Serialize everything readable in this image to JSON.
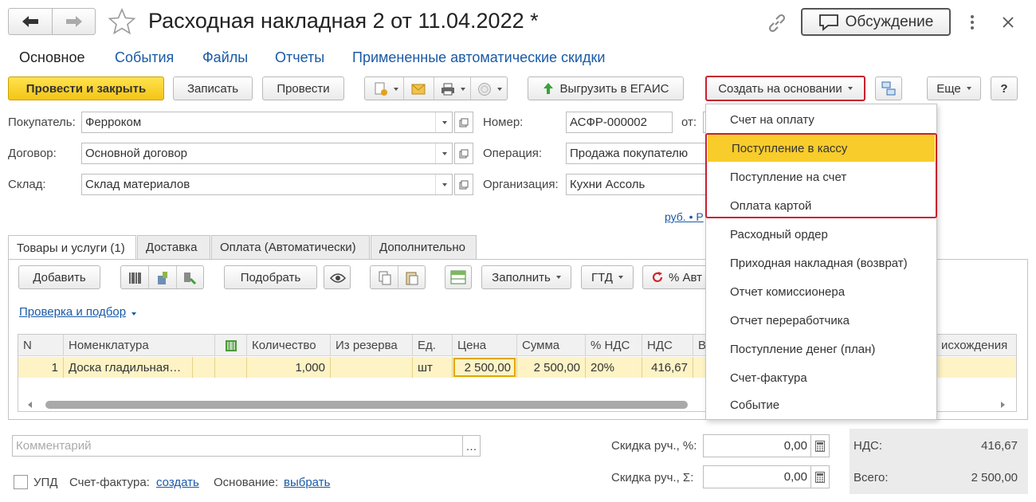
{
  "window": {
    "title": "Расходная накладная 2 от 11.04.2022 *",
    "discussion": "Обсуждение"
  },
  "tabs": [
    "Основное",
    "События",
    "Файлы",
    "Отчеты",
    "Примененные автоматические скидки"
  ],
  "toolbar": {
    "post_close": "Провести и закрыть",
    "save": "Записать",
    "post": "Провести",
    "upload_egais": "Выгрузить в ЕГАИС",
    "create_based": "Создать на основании",
    "more": "Еще",
    "help": "?"
  },
  "form": {
    "buyer_label": "Покупатель:",
    "buyer": "Ферроком",
    "contract_label": "Договор:",
    "contract": "Основной договор",
    "warehouse_label": "Склад:",
    "warehouse": "Склад материалов",
    "number_label": "Номер:",
    "number": "АСФР-000002",
    "from_label": "от:",
    "operation_label": "Операция:",
    "operation": "Продажа покупателю",
    "org_label": "Организация:",
    "org": "Кухни Ассоль",
    "currency_link": "руб. • Р"
  },
  "inner_tabs": [
    "Товары и услуги (1)",
    "Доставка",
    "Оплата (Автоматически)",
    "Дополнительно"
  ],
  "goods_toolbar": {
    "add": "Добавить",
    "pick": "Подобрать",
    "fill": "Заполнить",
    "gtd": "ГТД",
    "percent": "% Авт"
  },
  "check_link": "Проверка и подбор",
  "table": {
    "headers": [
      "N",
      "Номенклатура",
      "Количество",
      "Из резерва",
      "Ед.",
      "Цена",
      "Сумма",
      "% НДС",
      "НДС",
      "В",
      "исхождения"
    ],
    "row": {
      "n": "1",
      "item": "Доска гладильная…",
      "qty": "1,000",
      "unit": "шт",
      "price": "2 500,00",
      "sum": "2 500,00",
      "vat_rate": "20%",
      "vat": "416,67"
    }
  },
  "menu": {
    "items": [
      "Счет на оплату",
      "Поступление в кассу",
      "Поступление на счет",
      "Оплата картой",
      "Расходный ордер",
      "Приходная накладная (возврат)",
      "Отчет комиссионера",
      "Отчет переработчика",
      "Поступление денег (план)",
      "Счет-фактура",
      "Событие"
    ]
  },
  "footer": {
    "comment_placeholder": "Комментарий",
    "upd": "УПД",
    "invoice_label": "Счет-фактура:",
    "invoice_link": "создать",
    "basis_label": "Основание:",
    "basis_link": "выбрать",
    "discount_pct_label": "Скидка руч., %:",
    "discount_pct": "0,00",
    "discount_sum_label": "Скидка руч., Σ:",
    "discount_sum": "0,00",
    "vat_label": "НДС:",
    "vat": "416,67",
    "total_label": "Всего:",
    "total": "2 500,00"
  },
  "colors": {
    "accent": "#f4c515",
    "highlight": "#c8202f",
    "row_selected": "#fdf3c5",
    "link": "#1a5aa6"
  }
}
